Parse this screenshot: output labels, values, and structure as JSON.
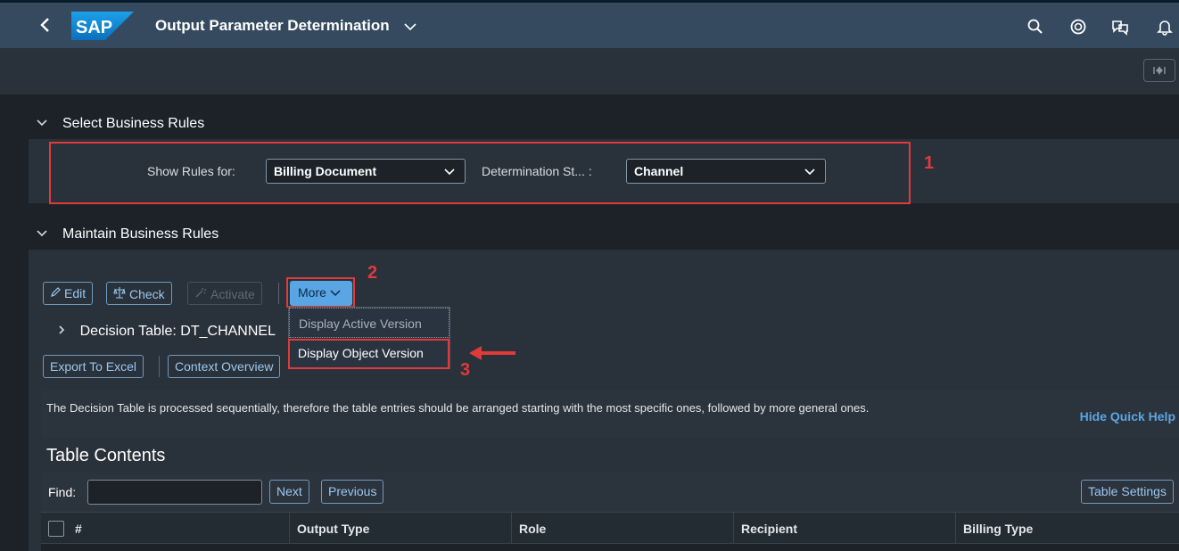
{
  "shell": {
    "back_icon": "chevron-left-icon",
    "logo": "SAP",
    "title": "Output Parameter Determination",
    "icons": [
      "search-icon",
      "copilot-icon",
      "notifications-chat-icon",
      "bell-icon"
    ]
  },
  "subbar": {
    "collapse_icon": "collapse-header-icon"
  },
  "select_section": {
    "title": "Select Business Rules",
    "show_rules_label": "Show Rules for:",
    "show_rules_value": "Billing Document",
    "det_step_label": "Determination St... :",
    "det_step_value": "Channel"
  },
  "maintain_section": {
    "title": "Maintain Business Rules",
    "toolbar": {
      "edit": "Edit",
      "check": "Check",
      "activate": "Activate",
      "more": "More"
    },
    "more_menu": [
      "Display Active Version",
      "Display Object Version"
    ],
    "decision_table_title": "Decision Table: DT_CHANNEL",
    "export": "Export To Excel",
    "context": "Context Overview",
    "info_text": "The Decision Table is processed sequentially, therefore the table entries should be arranged starting with the most specific ones, followed by more general ones.",
    "hide_help": "Hide Quick Help",
    "table_contents_title": "Table Contents",
    "find_label": "Find:",
    "next": "Next",
    "previous": "Previous",
    "table_settings": "Table Settings",
    "columns": [
      "#",
      "Output Type",
      "Role",
      "Recipient",
      "Billing Type"
    ]
  },
  "annotations": {
    "n1": "1",
    "n2": "2",
    "n3": "3"
  },
  "colors": {
    "shell": "#354a5f",
    "accent": "#5aa6e4",
    "annotation_red": "#e03a3a",
    "background": "#1c2228"
  }
}
